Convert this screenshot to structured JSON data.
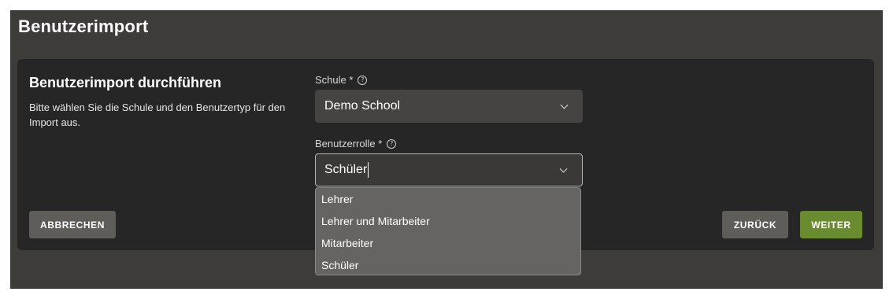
{
  "page": {
    "title": "Benutzerimport"
  },
  "card": {
    "title": "Benutzerimport durchführen",
    "description": "Bitte wählen Sie die Schule und den Benutzertyp für den Import aus."
  },
  "school_field": {
    "label": "Schule *",
    "value": "Demo School"
  },
  "role_field": {
    "label": "Benutzerrolle *",
    "value": "Schüler",
    "options": [
      "Lehrer",
      "Lehrer und Mitarbeiter",
      "Mitarbeiter",
      "Schüler"
    ]
  },
  "buttons": {
    "cancel": "ABBRECHEN",
    "back": "ZURÜCK",
    "next": "WEITER"
  },
  "colors": {
    "background": "#3d3c39",
    "card": "#262626",
    "primary": "#6b8b30",
    "secondary": "#5e5d5a"
  }
}
